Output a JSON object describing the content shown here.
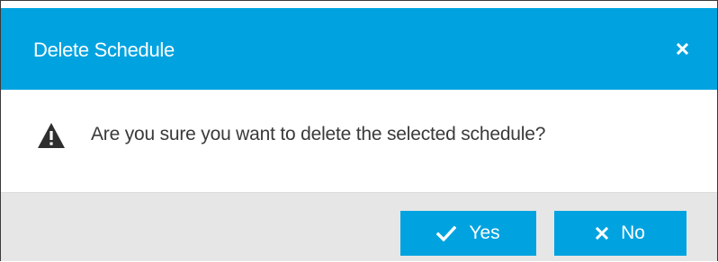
{
  "dialog": {
    "title": "Delete Schedule",
    "close_icon": "close-icon",
    "message": "Are you sure you want to delete the selected schedule?",
    "message_icon": "warning-icon"
  },
  "buttons": {
    "yes": {
      "label": "Yes",
      "icon": "check-icon"
    },
    "no": {
      "label": "No",
      "icon": "close-icon"
    }
  },
  "colors": {
    "accent": "#00a3e0",
    "footer": "#e6e6e6",
    "text": "#3a3a3a"
  }
}
